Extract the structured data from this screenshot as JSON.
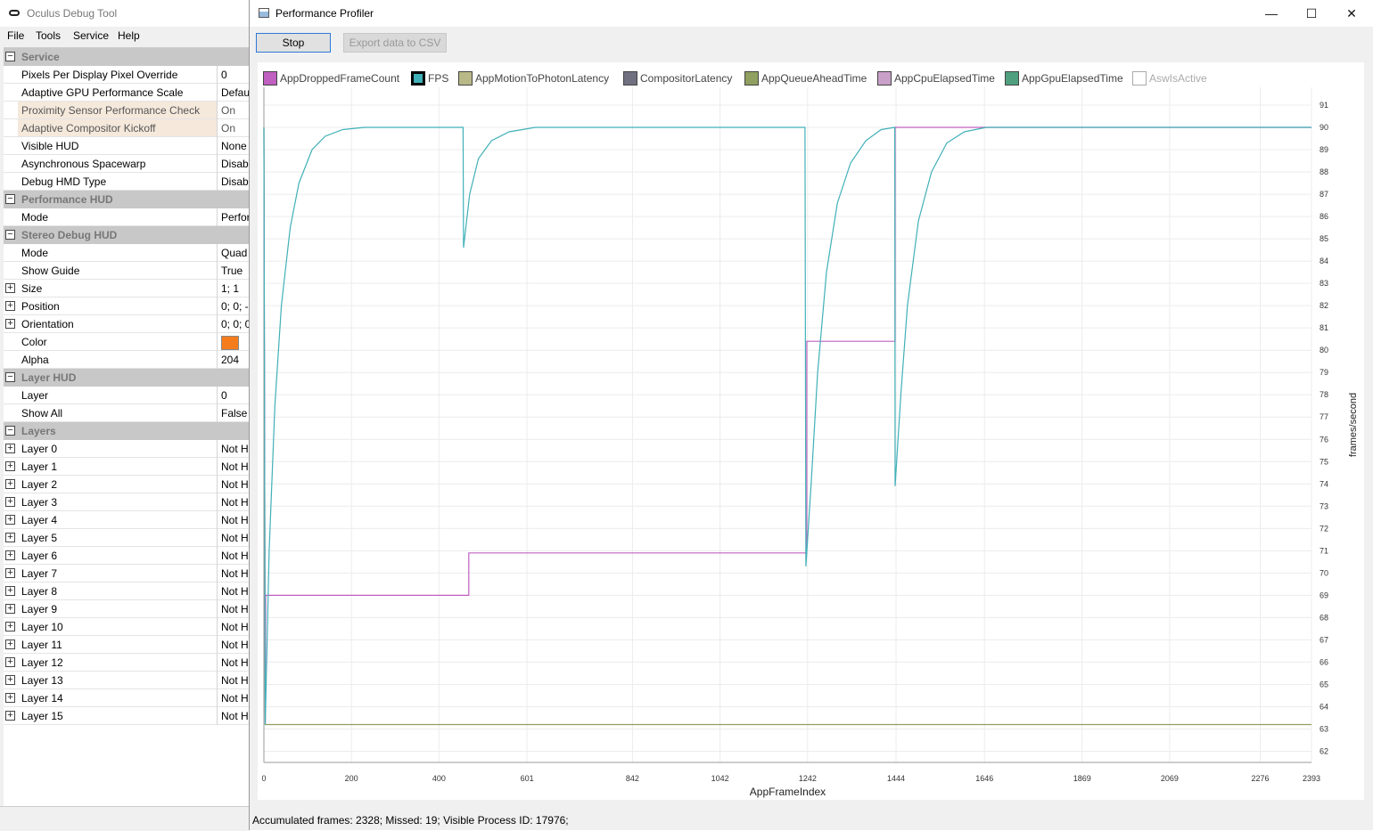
{
  "debug_tool": {
    "title": "Oculus Debug Tool",
    "menu": [
      "File",
      "Tools",
      "Service",
      "Help"
    ],
    "rows": [
      {
        "kind": "cat",
        "name": "Service",
        "toggle": "−"
      },
      {
        "kind": "prop",
        "name": "Pixels Per Display Pixel Override",
        "value": "0"
      },
      {
        "kind": "prop",
        "name": "Adaptive GPU Performance Scale",
        "value": "Defau"
      },
      {
        "kind": "prop",
        "name": "Proximity Sensor Performance Check",
        "value": "On",
        "highlight": true
      },
      {
        "kind": "prop",
        "name": "Adaptive Compositor Kickoff",
        "value": "On",
        "highlight": true
      },
      {
        "kind": "prop",
        "name": "Visible HUD",
        "value": "None"
      },
      {
        "kind": "prop",
        "name": "Asynchronous Spacewarp",
        "value": "Disabl"
      },
      {
        "kind": "prop",
        "name": "Debug HMD Type",
        "value": "Disabl"
      },
      {
        "kind": "cat",
        "name": "Performance HUD",
        "toggle": "−"
      },
      {
        "kind": "prop",
        "name": "Mode",
        "value": "Perfor"
      },
      {
        "kind": "cat",
        "name": "Stereo Debug HUD",
        "toggle": "−"
      },
      {
        "kind": "prop",
        "name": "Mode",
        "value": "Quad"
      },
      {
        "kind": "prop",
        "name": "Show Guide",
        "value": "True"
      },
      {
        "kind": "prop",
        "name": "Size",
        "value": "1; 1",
        "toggle": "+"
      },
      {
        "kind": "prop",
        "name": "Position",
        "value": "0; 0; -",
        "toggle": "+"
      },
      {
        "kind": "prop",
        "name": "Orientation",
        "value": "0; 0; 0",
        "toggle": "+"
      },
      {
        "kind": "prop",
        "name": "Color",
        "value": "",
        "swatch": "#f57c1c"
      },
      {
        "kind": "prop",
        "name": "Alpha",
        "value": "204"
      },
      {
        "kind": "cat",
        "name": "Layer HUD",
        "toggle": "−"
      },
      {
        "kind": "prop",
        "name": "Layer",
        "value": "0"
      },
      {
        "kind": "prop",
        "name": "Show All",
        "value": "False"
      },
      {
        "kind": "cat",
        "name": "Layers",
        "toggle": "−"
      },
      {
        "kind": "prop",
        "name": "Layer 0",
        "value": "Not H",
        "toggle": "+"
      },
      {
        "kind": "prop",
        "name": "Layer 1",
        "value": "Not H",
        "toggle": "+"
      },
      {
        "kind": "prop",
        "name": "Layer 2",
        "value": "Not H",
        "toggle": "+"
      },
      {
        "kind": "prop",
        "name": "Layer 3",
        "value": "Not H",
        "toggle": "+"
      },
      {
        "kind": "prop",
        "name": "Layer 4",
        "value": "Not H",
        "toggle": "+"
      },
      {
        "kind": "prop",
        "name": "Layer 5",
        "value": "Not H",
        "toggle": "+"
      },
      {
        "kind": "prop",
        "name": "Layer 6",
        "value": "Not H",
        "toggle": "+"
      },
      {
        "kind": "prop",
        "name": "Layer 7",
        "value": "Not H",
        "toggle": "+"
      },
      {
        "kind": "prop",
        "name": "Layer 8",
        "value": "Not H",
        "toggle": "+"
      },
      {
        "kind": "prop",
        "name": "Layer 9",
        "value": "Not H",
        "toggle": "+"
      },
      {
        "kind": "prop",
        "name": "Layer 10",
        "value": "Not H",
        "toggle": "+"
      },
      {
        "kind": "prop",
        "name": "Layer 11",
        "value": "Not H",
        "toggle": "+"
      },
      {
        "kind": "prop",
        "name": "Layer 12",
        "value": "Not H",
        "toggle": "+"
      },
      {
        "kind": "prop",
        "name": "Layer 13",
        "value": "Not H",
        "toggle": "+"
      },
      {
        "kind": "prop",
        "name": "Layer 14",
        "value": "Not H",
        "toggle": "+"
      },
      {
        "kind": "prop",
        "name": "Layer 15",
        "value": "Not H",
        "toggle": "+"
      }
    ]
  },
  "profiler": {
    "title": "Performance Profiler",
    "window_controls": {
      "minimize": "—",
      "maximize": "☐",
      "close": "✕"
    },
    "stop_label": "Stop",
    "export_label": "Export data to CSV",
    "status": "Accumulated frames: 2328; Missed: 19; Visible Process ID: 17976;",
    "legend": [
      {
        "name": "AppDroppedFrameCount",
        "color": "#c060c0",
        "state": "on"
      },
      {
        "name": "FPS",
        "color": "#40b0b8",
        "state": "selected"
      },
      {
        "name": "AppMotionToPhotonLatency",
        "color": "#b8b888",
        "state": "on"
      },
      {
        "name": "CompositorLatency",
        "color": "#707080",
        "state": "on"
      },
      {
        "name": "AppQueueAheadTime",
        "color": "#90a060",
        "state": "on"
      },
      {
        "name": "AppCpuElapsedTime",
        "color": "#c8a0c8",
        "state": "on"
      },
      {
        "name": "AppGpuElapsedTime",
        "color": "#50a080",
        "state": "on"
      },
      {
        "name": "AswIsActive",
        "color": "#ffffff",
        "state": "off"
      }
    ]
  },
  "chart_data": {
    "type": "line",
    "xlabel": "AppFrameIndex",
    "ylabel": "frames/second",
    "x_ticks": [
      0,
      200,
      400,
      601,
      842,
      1042,
      1242,
      1444,
      1646,
      1869,
      2069,
      2276,
      2393
    ],
    "y_ticks": [
      62,
      63,
      64,
      65,
      66,
      67,
      68,
      69,
      70,
      71,
      72,
      73,
      74,
      75,
      76,
      77,
      78,
      79,
      80,
      81,
      82,
      83,
      84,
      85,
      86,
      87,
      88,
      89,
      90,
      91
    ],
    "xlim": [
      0,
      2393
    ],
    "ylim": [
      61.5,
      91.8
    ],
    "grid": true,
    "legend_position": "top",
    "series": [
      {
        "name": "FPS",
        "color": "#40b0b8",
        "points": [
          [
            0,
            90
          ],
          [
            3,
            63.2
          ],
          [
            12,
            71
          ],
          [
            25,
            77.5
          ],
          [
            40,
            82
          ],
          [
            60,
            85.5
          ],
          [
            80,
            87.5
          ],
          [
            110,
            89
          ],
          [
            140,
            89.6
          ],
          [
            180,
            89.9
          ],
          [
            230,
            90
          ],
          [
            455,
            90
          ],
          [
            456,
            84.6
          ],
          [
            470,
            87
          ],
          [
            490,
            88.6
          ],
          [
            520,
            89.4
          ],
          [
            560,
            89.8
          ],
          [
            620,
            90
          ],
          [
            1236,
            90
          ],
          [
            1238,
            70.3
          ],
          [
            1250,
            74
          ],
          [
            1265,
            79
          ],
          [
            1285,
            83.5
          ],
          [
            1310,
            86.6
          ],
          [
            1340,
            88.4
          ],
          [
            1375,
            89.4
          ],
          [
            1410,
            89.9
          ],
          [
            1441,
            90
          ],
          [
            1442,
            73.9
          ],
          [
            1455,
            78
          ],
          [
            1470,
            82
          ],
          [
            1495,
            85.8
          ],
          [
            1525,
            88
          ],
          [
            1560,
            89.3
          ],
          [
            1600,
            89.8
          ],
          [
            1650,
            90
          ],
          [
            2393,
            90
          ]
        ]
      },
      {
        "name": "AppDroppedFrameCount",
        "color": "#c060c0",
        "points": [
          [
            0,
            90
          ],
          [
            3,
            63.2
          ],
          [
            4,
            69
          ],
          [
            468,
            69
          ],
          [
            468,
            70.9
          ],
          [
            1240,
            70.9
          ],
          [
            1240,
            80.4
          ],
          [
            1442,
            80.4
          ],
          [
            1442,
            90
          ],
          [
            2393,
            90
          ]
        ]
      },
      {
        "name": "AppQueueAheadTime",
        "color": "#90a060",
        "points": [
          [
            0,
            90
          ],
          [
            3,
            63.2
          ],
          [
            2393,
            63.2
          ]
        ]
      }
    ]
  }
}
